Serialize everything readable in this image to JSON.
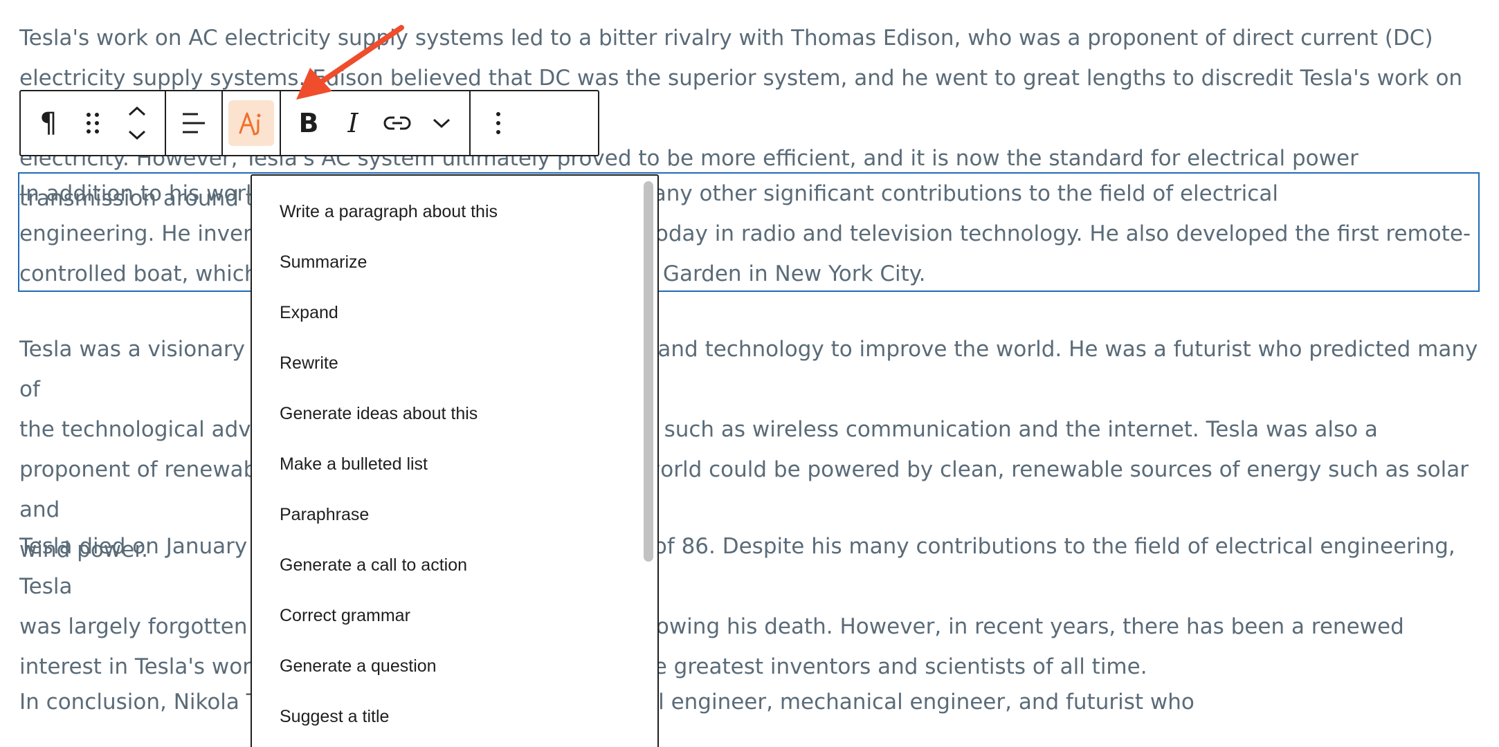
{
  "content": {
    "paragraphs": [
      "Tesla's work on AC electricity supply systems led to a bitter rivalry with Thomas Edison, who was a proponent of direct current (DC)\nelectricity supply systems. Edison believed that DC was the superior system, and he went to great lengths to discredit Tesla's work on AC\nelectricity. However, Tesla's AC system ultimately proved to be more efficient, and it is now the standard for electrical power transmission around the world.",
      "In addition to his work on AC electricity, Tesla also made many other significant contributions to the field of electrical\nengineering. He invented the Tesla coil, which is still used today in radio and television technology. He also developed the first remote-\ncontrolled boat, which he demonstrated at Madison Square Garden in New York City.",
      "Tesla was a visionary who believed in the power of science and technology to improve the world. He was a futurist who predicted many of\nthe technological advances that we take for granted today, such as wireless communication and the internet. Tesla was also a\nproponent of renewable energy, and he believed that the world could be powered by clean, renewable sources of energy such as solar and\nwind power.",
      "Tesla died on January 7, 1943, in New York City, at the age of 86. Despite his many contributions to the field of electrical engineering, Tesla\nwas largely forgotten by the general public in the years following his death. However, in recent years, there has been a renewed\ninterest in Tesla's work, and he is now considered one of the greatest inventors and scientists of all time.",
      "In conclusion, Nikola Tesla was a brilliant inventor, electrical engineer, mechanical engineer, and futurist who"
    ]
  },
  "toolbar": {
    "icons": {
      "paragraph": "pilcrow-icon",
      "drag": "drag-handle-icon",
      "move": "chevron-up-down-icon",
      "align": "align-left-icon",
      "ai": "ai-assistant-icon",
      "bold": "bold-icon",
      "italic": "italic-icon",
      "link": "link-icon",
      "more_formatting": "chevron-down-icon",
      "options": "more-vertical-icon"
    },
    "bold_label": "B",
    "italic_label": "I",
    "paragraph_label": "¶",
    "ai_label": "Ai"
  },
  "menu": {
    "items": [
      "Write a paragraph about this",
      "Summarize",
      "Expand",
      "Rewrite",
      "Generate ideas about this",
      "Make a bulleted list",
      "Paraphrase",
      "Generate a call to action",
      "Correct grammar",
      "Generate a question",
      "Suggest a title"
    ]
  },
  "colors": {
    "text": "#5a6b78",
    "selection_border": "#1e6bb8",
    "ai_accent": "#f0702e",
    "ai_background": "#fbe3cf",
    "arrow": "#ef4d2c"
  }
}
